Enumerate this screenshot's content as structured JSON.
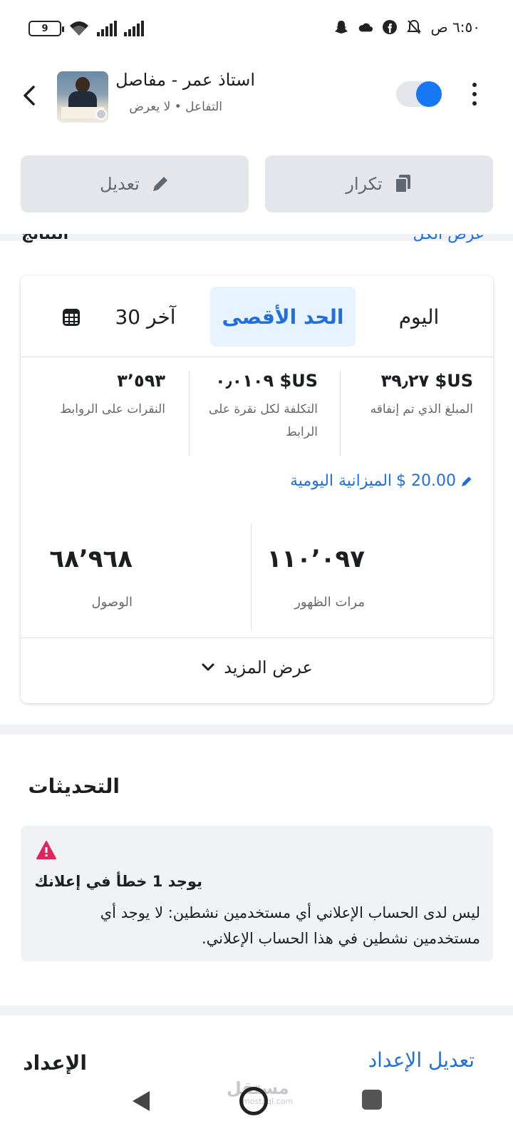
{
  "status_bar": {
    "battery": "9",
    "time": "٦:٥٠ ص"
  },
  "header": {
    "title": "استاذ عمر - مفاصل",
    "subtitle": "التفاعل • لا يعرض"
  },
  "actions": {
    "duplicate_label": "تكرار",
    "edit_label": "تعديل"
  },
  "cutoff": {
    "left": "النتائج",
    "right": "عرض الكل"
  },
  "metrics_card": {
    "tabs": {
      "today": "اليوم",
      "lifetime": "الحد الأقصى",
      "last30": "آخر 30"
    },
    "amount_spent": {
      "value": "US$ ٣٩٫٢٧",
      "label": "المبلغ الذي تم إنفاقه"
    },
    "cpc": {
      "value": "US$ ٠٫٠١٠٩",
      "label": "التكلفة لكل نقرة على الرابط"
    },
    "link_clicks": {
      "value": "٣٬٥٩٣",
      "label": "النقرات على الروابط"
    },
    "daily_budget": {
      "amount": "$ 20.00",
      "label": "الميزانية اليومية"
    },
    "impressions": {
      "value": "١١٠٬٠٩٧",
      "label": "مرات الظهور"
    },
    "reach": {
      "value": "٦٨٬٩٦٨",
      "label": "الوصول"
    },
    "see_more": "عرض المزيد"
  },
  "updates": {
    "title": "التحديثات",
    "alert_title": "يوجد 1 خطأ في إعلانك",
    "alert_body": "ليس لدى الحساب الإعلاني أي مستخدمين نشطين: لا يوجد أي مستخدمين نشطين في هذا الحساب الإعلاني."
  },
  "setup": {
    "title": "الإعداد",
    "edit_link": "تعديل الإعداد"
  },
  "watermark": {
    "text": "مستقل",
    "sub": "mostaql.com"
  },
  "colors": {
    "accent": "#1877f2",
    "link": "#216fdb",
    "error": "#e0245e"
  }
}
